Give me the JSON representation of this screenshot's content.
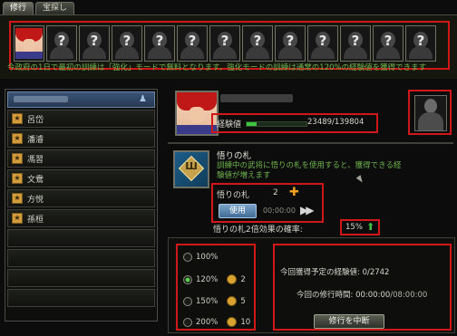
{
  "tabs": [
    {
      "label": "修行",
      "active": true
    },
    {
      "label": "宝探し",
      "active": false
    }
  ],
  "portraits": {
    "total": 13,
    "unlocked": 1,
    "locked_glyph": "?"
  },
  "notice": "今政府の1日で最初の訓練は「強化」モードで無料となります。強化モードの訓練は通常の120%の経験値を獲得できます",
  "left_panel": {
    "people_icon": "person-icon",
    "items": [
      "呂岱",
      "潘濬",
      "馮習",
      "文鴦",
      "方悦",
      "孫桓",
      "",
      "",
      "",
      ""
    ]
  },
  "exp": {
    "label": "経験値",
    "value": "23489/139804",
    "progress": 0.168
  },
  "card": {
    "title": "悟りの札",
    "icon_mark": "Ш",
    "description": "訓練中の武将に悟りの札を使用すると、獲得できる経験値が増えます",
    "use_label": "悟りの札",
    "count": "2",
    "use_button": "使用",
    "timer": "00:00:00",
    "rate_label": "悟りの札2倍効果の確率:",
    "rate_value": "15%"
  },
  "options": [
    {
      "label": "100%",
      "selected": false,
      "coin": null
    },
    {
      "label": "120%",
      "selected": true,
      "coin": "2"
    },
    {
      "label": "150%",
      "selected": false,
      "coin": "5"
    },
    {
      "label": "200%",
      "selected": false,
      "coin": "10"
    }
  ],
  "info": {
    "expected_label": "今回獲得予定の経験値: 0/2742",
    "time_label": "今回の修行時間:",
    "time_value": "00:00:00",
    "time_total": "/08:00:00",
    "interrupt_button": "修行を中断"
  }
}
